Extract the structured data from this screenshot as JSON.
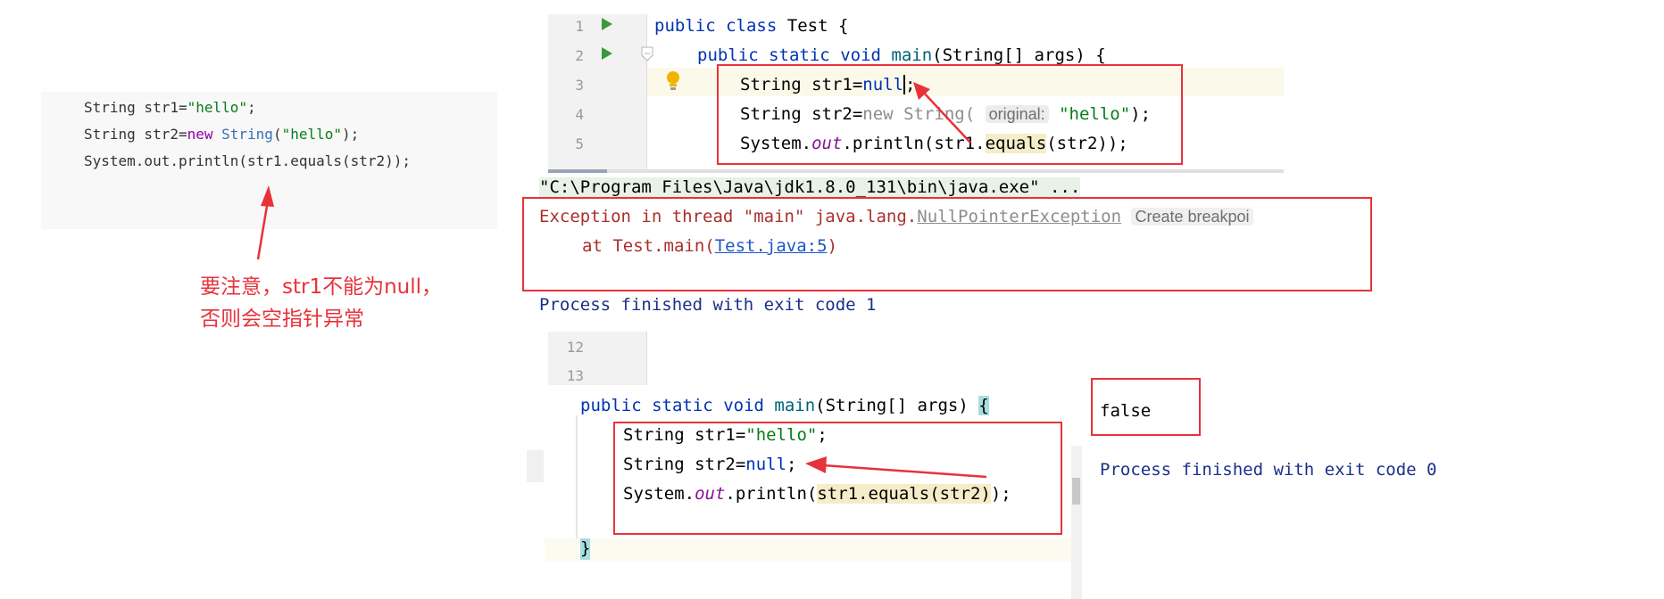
{
  "left_snippet": {
    "lines": [
      "String str1=\"hello\";",
      "String str2=new String(\"hello\");",
      "System.out.println(str1.equals(str2));"
    ]
  },
  "annotation": {
    "line1": "要注意，str1不能为null，",
    "line2": "否则会空指针异常"
  },
  "editor_top": {
    "line_numbers": [
      "1",
      "2",
      "3",
      "4",
      "5"
    ],
    "l1_public": "public",
    "l1_class": "class",
    "l1_name": "Test {",
    "l2_public": "public",
    "l2_static": "static",
    "l2_void": "void",
    "l2_main": "main",
    "l2_rest": "(String[] args) {",
    "l3_text": "String str1=",
    "l3_null": "null",
    "l3_end": ";",
    "l4_text": "String str2=",
    "l4_new": "new",
    "l4_string": "String(",
    "l4_hint": "original:",
    "l4_str": "\"hello\"",
    "l4_end": ");",
    "l5_sys": "System.",
    "l5_out": "out",
    "l5_println": ".println(str1.",
    "l5_equals": "equals",
    "l5_end": "(str2));"
  },
  "console_top": {
    "path": "\"C:\\Program Files\\Java\\jdk1.8.0_131\\bin\\java.exe\" ...",
    "exception_prefix": "Exception in thread \"main\" java.lang.",
    "exception_name": "NullPointerException",
    "create_breakpoint": "Create breakpoi",
    "at_prefix": "at Test.main(",
    "at_link": "Test.java:5",
    "at_suffix": ")",
    "finished": "Process finished with exit code 1"
  },
  "editor_bottom": {
    "line_numbers": [
      "12",
      "13"
    ],
    "main_public": "public",
    "main_static": "static",
    "main_void": "void",
    "main_name": "main",
    "main_rest": "(String[] args)",
    "main_brace": "{",
    "l1_text": "String str1=",
    "l1_str": "\"hello\"",
    "l1_end": ";",
    "l2_text": "String str2=",
    "l2_null": "null",
    "l2_end": ";",
    "l3_sys": "System.",
    "l3_out": "out",
    "l3_println": ".println(",
    "l3_expr": "str1.equals(str2)",
    "l3_end": ");",
    "close_brace": "}"
  },
  "console_bottom": {
    "output": "false",
    "finished": "Process finished with exit code 0"
  },
  "colors": {
    "annotation_red": "#e8323a",
    "keyword_blue": "#0033b3",
    "string_green": "#067d17",
    "error_red": "#a9302a"
  }
}
